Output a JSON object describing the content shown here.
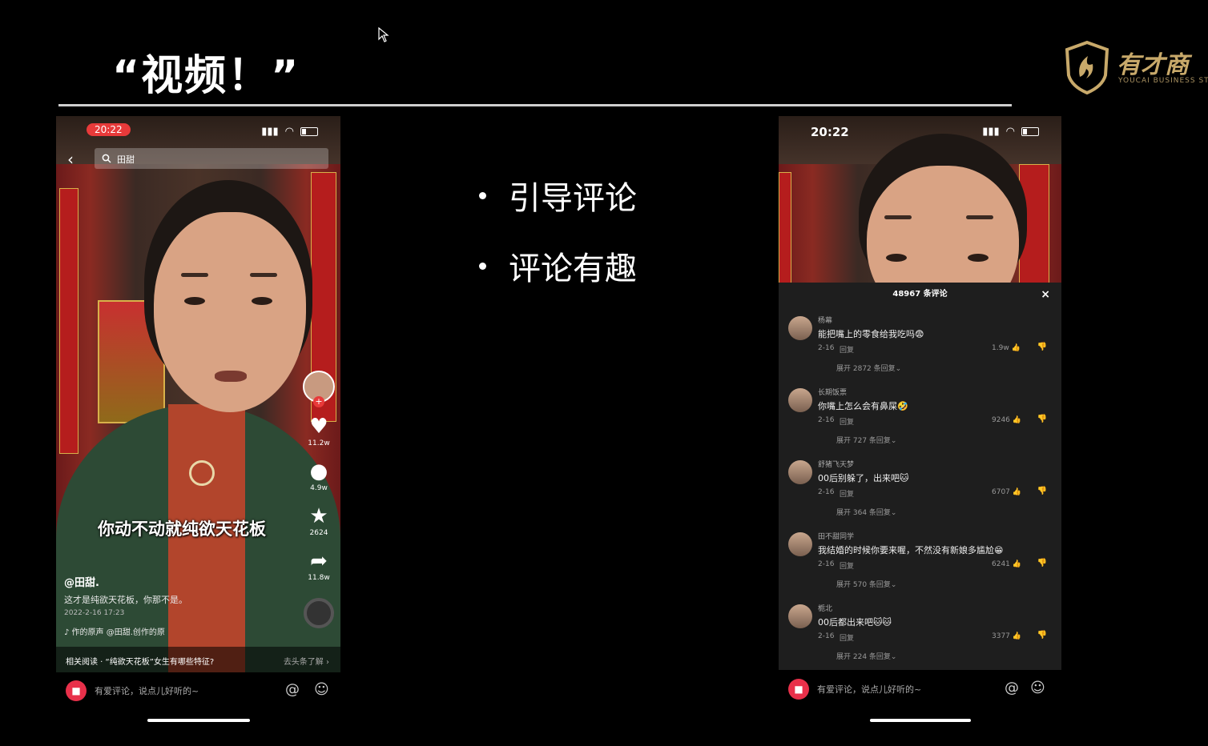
{
  "slide": {
    "title": "“视频！”",
    "bullets": [
      "引导评论",
      "评论有趣"
    ],
    "logo_cn": "有才商",
    "logo_en": "YOUCAI BUSINESS ST"
  },
  "left_phone": {
    "time": "20:22",
    "search_text": "田甜",
    "caption": "你动不动就纯欲天花板",
    "author": "@田甜.",
    "description": "这才是纯欲天花板，你那不是。",
    "date": "2022-2-16 17:23",
    "music": "♪ 作的原声   @田甜.创作的原",
    "likes": "11.2w",
    "comments": "4.9w",
    "favorites": "2624",
    "shares": "11.8w",
    "related_left": "相关阅读 · “纯欲天花板”女生有哪些特征?",
    "related_right": "去头条了解 ›",
    "input_placeholder": "有爱评论，说点儿好听的~"
  },
  "right_phone": {
    "time": "20:22",
    "comment_count": "48967 条评论",
    "close": "×",
    "input_placeholder": "有爱评论，说点儿好听的~",
    "comments": [
      {
        "name": "杨幕",
        "text": "能把嘴上的零食给我吃吗😨",
        "date": "2-16",
        "reply": "回复",
        "likes": "1.9w",
        "expand": "展开 2872 条回复⌄"
      },
      {
        "name": "长期饭票",
        "text": "你嘴上怎么会有鼻屎🤣",
        "date": "2-16",
        "reply": "回复",
        "likes": "9246",
        "expand": "展开 727 条回复⌄"
      },
      {
        "name": "舒猪飞天梦",
        "text": "00后别躲了，出来吧🐱",
        "date": "2-16",
        "reply": "回复",
        "likes": "6707",
        "expand": "展开 364 条回复⌄"
      },
      {
        "name": "田不甜同学",
        "text": "我结婚的时候你要来喔，不然没有新娘多尴尬😁",
        "date": "2-16",
        "reply": "回复",
        "likes": "6241",
        "expand": "展开 570 条回复⌄"
      },
      {
        "name": "栀北",
        "text": "00后都出来吧🐱🐱",
        "date": "2-16",
        "reply": "回复",
        "likes": "3377",
        "expand": "展开 224 条回复⌄"
      }
    ]
  },
  "colors": {
    "accent_red": "#e83a3a",
    "gold": "#c8a96a",
    "panel_bg": "#1e1e1e"
  }
}
